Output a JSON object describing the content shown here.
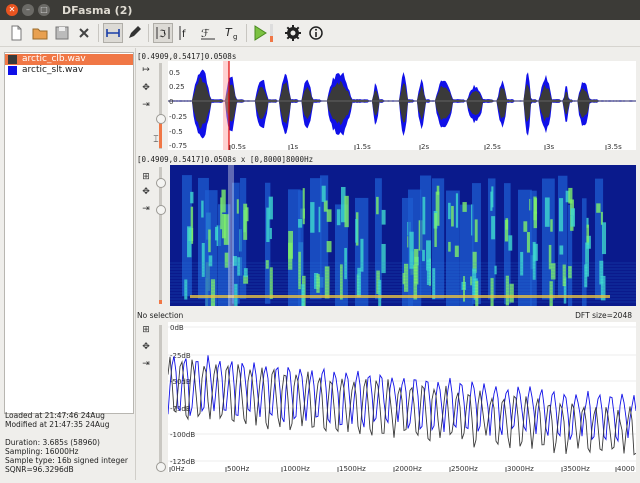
{
  "window": {
    "title": "DFasma (2)"
  },
  "toolbar": {
    "icons": [
      "new-file-icon",
      "open-folder-icon",
      "save-icon",
      "close-file-icon",
      "select-time-icon",
      "edit-pencil-icon",
      "time-aligned-icon",
      "time-cursor-icon",
      "time-fx-icon",
      "time-pitch-icon",
      "play-icon",
      "settings-gear-icon",
      "info-icon"
    ]
  },
  "files": [
    {
      "name": "arctic_clb.wav",
      "color": "#3a3a3a",
      "selected": true
    },
    {
      "name": "arctic_slt.wav",
      "color": "#1010e8",
      "selected": false
    }
  ],
  "file_info": {
    "loaded": "Loaded at 21:47:46 24Aug",
    "modified": "Modified at 21:47:35 24Aug",
    "duration": "Duration: 3.685s (58960)",
    "sampling": "Sampling: 16000Hz",
    "sample_type": "Sample type: 16b signed integer",
    "sqnr": "SQNR=96.3296dB"
  },
  "waveform": {
    "header": "[0.4909,0.5417]0.0508s",
    "yticks": [
      "0.5",
      "0.25",
      "0",
      "-0.25",
      "-0.5",
      "-0.75"
    ],
    "xticks": [
      "0.5s",
      "1s",
      "1.5s",
      "2s",
      "2.5s",
      "3s",
      "3.5s"
    ]
  },
  "spectrogram": {
    "header": "[0.4909,0.5417]0.0508s x [0,8000]8000Hz"
  },
  "spectrum": {
    "status": "No selection",
    "dft_size": "DFT size=2048",
    "yticks": [
      "0dB",
      "-25dB",
      "-50dB",
      "-75dB",
      "-100dB",
      "-125dB"
    ],
    "xticks": [
      "0Hz",
      "500Hz",
      "1000Hz",
      "1500Hz",
      "2000Hz",
      "2500Hz",
      "3000Hz",
      "3500Hz",
      "4000"
    ]
  },
  "colors": {
    "accent": "#f07746",
    "wave_dark": "#3a3a3a",
    "wave_blue": "#1010e8",
    "cursor": "#e00000"
  }
}
